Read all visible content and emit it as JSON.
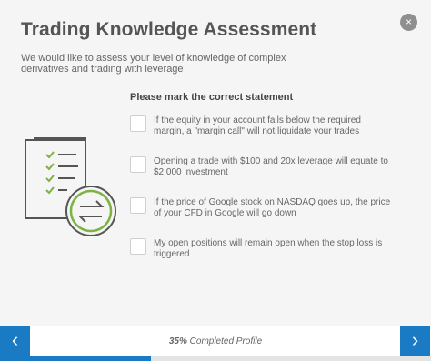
{
  "header": {
    "title": "Trading Knowledge Assessment",
    "subtitle": "We would like to assess your level of knowledge of complex derivatives and trading with leverage",
    "close_icon": "×"
  },
  "question": {
    "prompt": "Please mark the correct statement",
    "options": [
      {
        "label": "If the equity in your account falls below the required margin, a \"margin call\" will not liquidate your trades",
        "checked": false
      },
      {
        "label": "Opening a trade with $100 and 20x leverage will equate to $2,000 investment",
        "checked": false
      },
      {
        "label": "If the price of Google stock on NASDAQ goes up, the price of your CFD in Google will go down",
        "checked": false
      },
      {
        "label": "My open positions will remain open when the stop loss is triggered",
        "checked": false
      }
    ]
  },
  "footer": {
    "prev_icon": "‹",
    "next_icon": "›",
    "progress_value": "35%",
    "progress_label": "Completed Profile",
    "progress_fraction": 0.35
  },
  "colors": {
    "accent": "#1a7ac4",
    "check_green": "#7cb342",
    "illustration_gray": "#555555",
    "background": "#f5f5f5"
  },
  "icons": {
    "illustration": "checklist-exchange-icon",
    "close": "close-icon",
    "prev": "chevron-left-icon",
    "next": "chevron-right-icon"
  }
}
